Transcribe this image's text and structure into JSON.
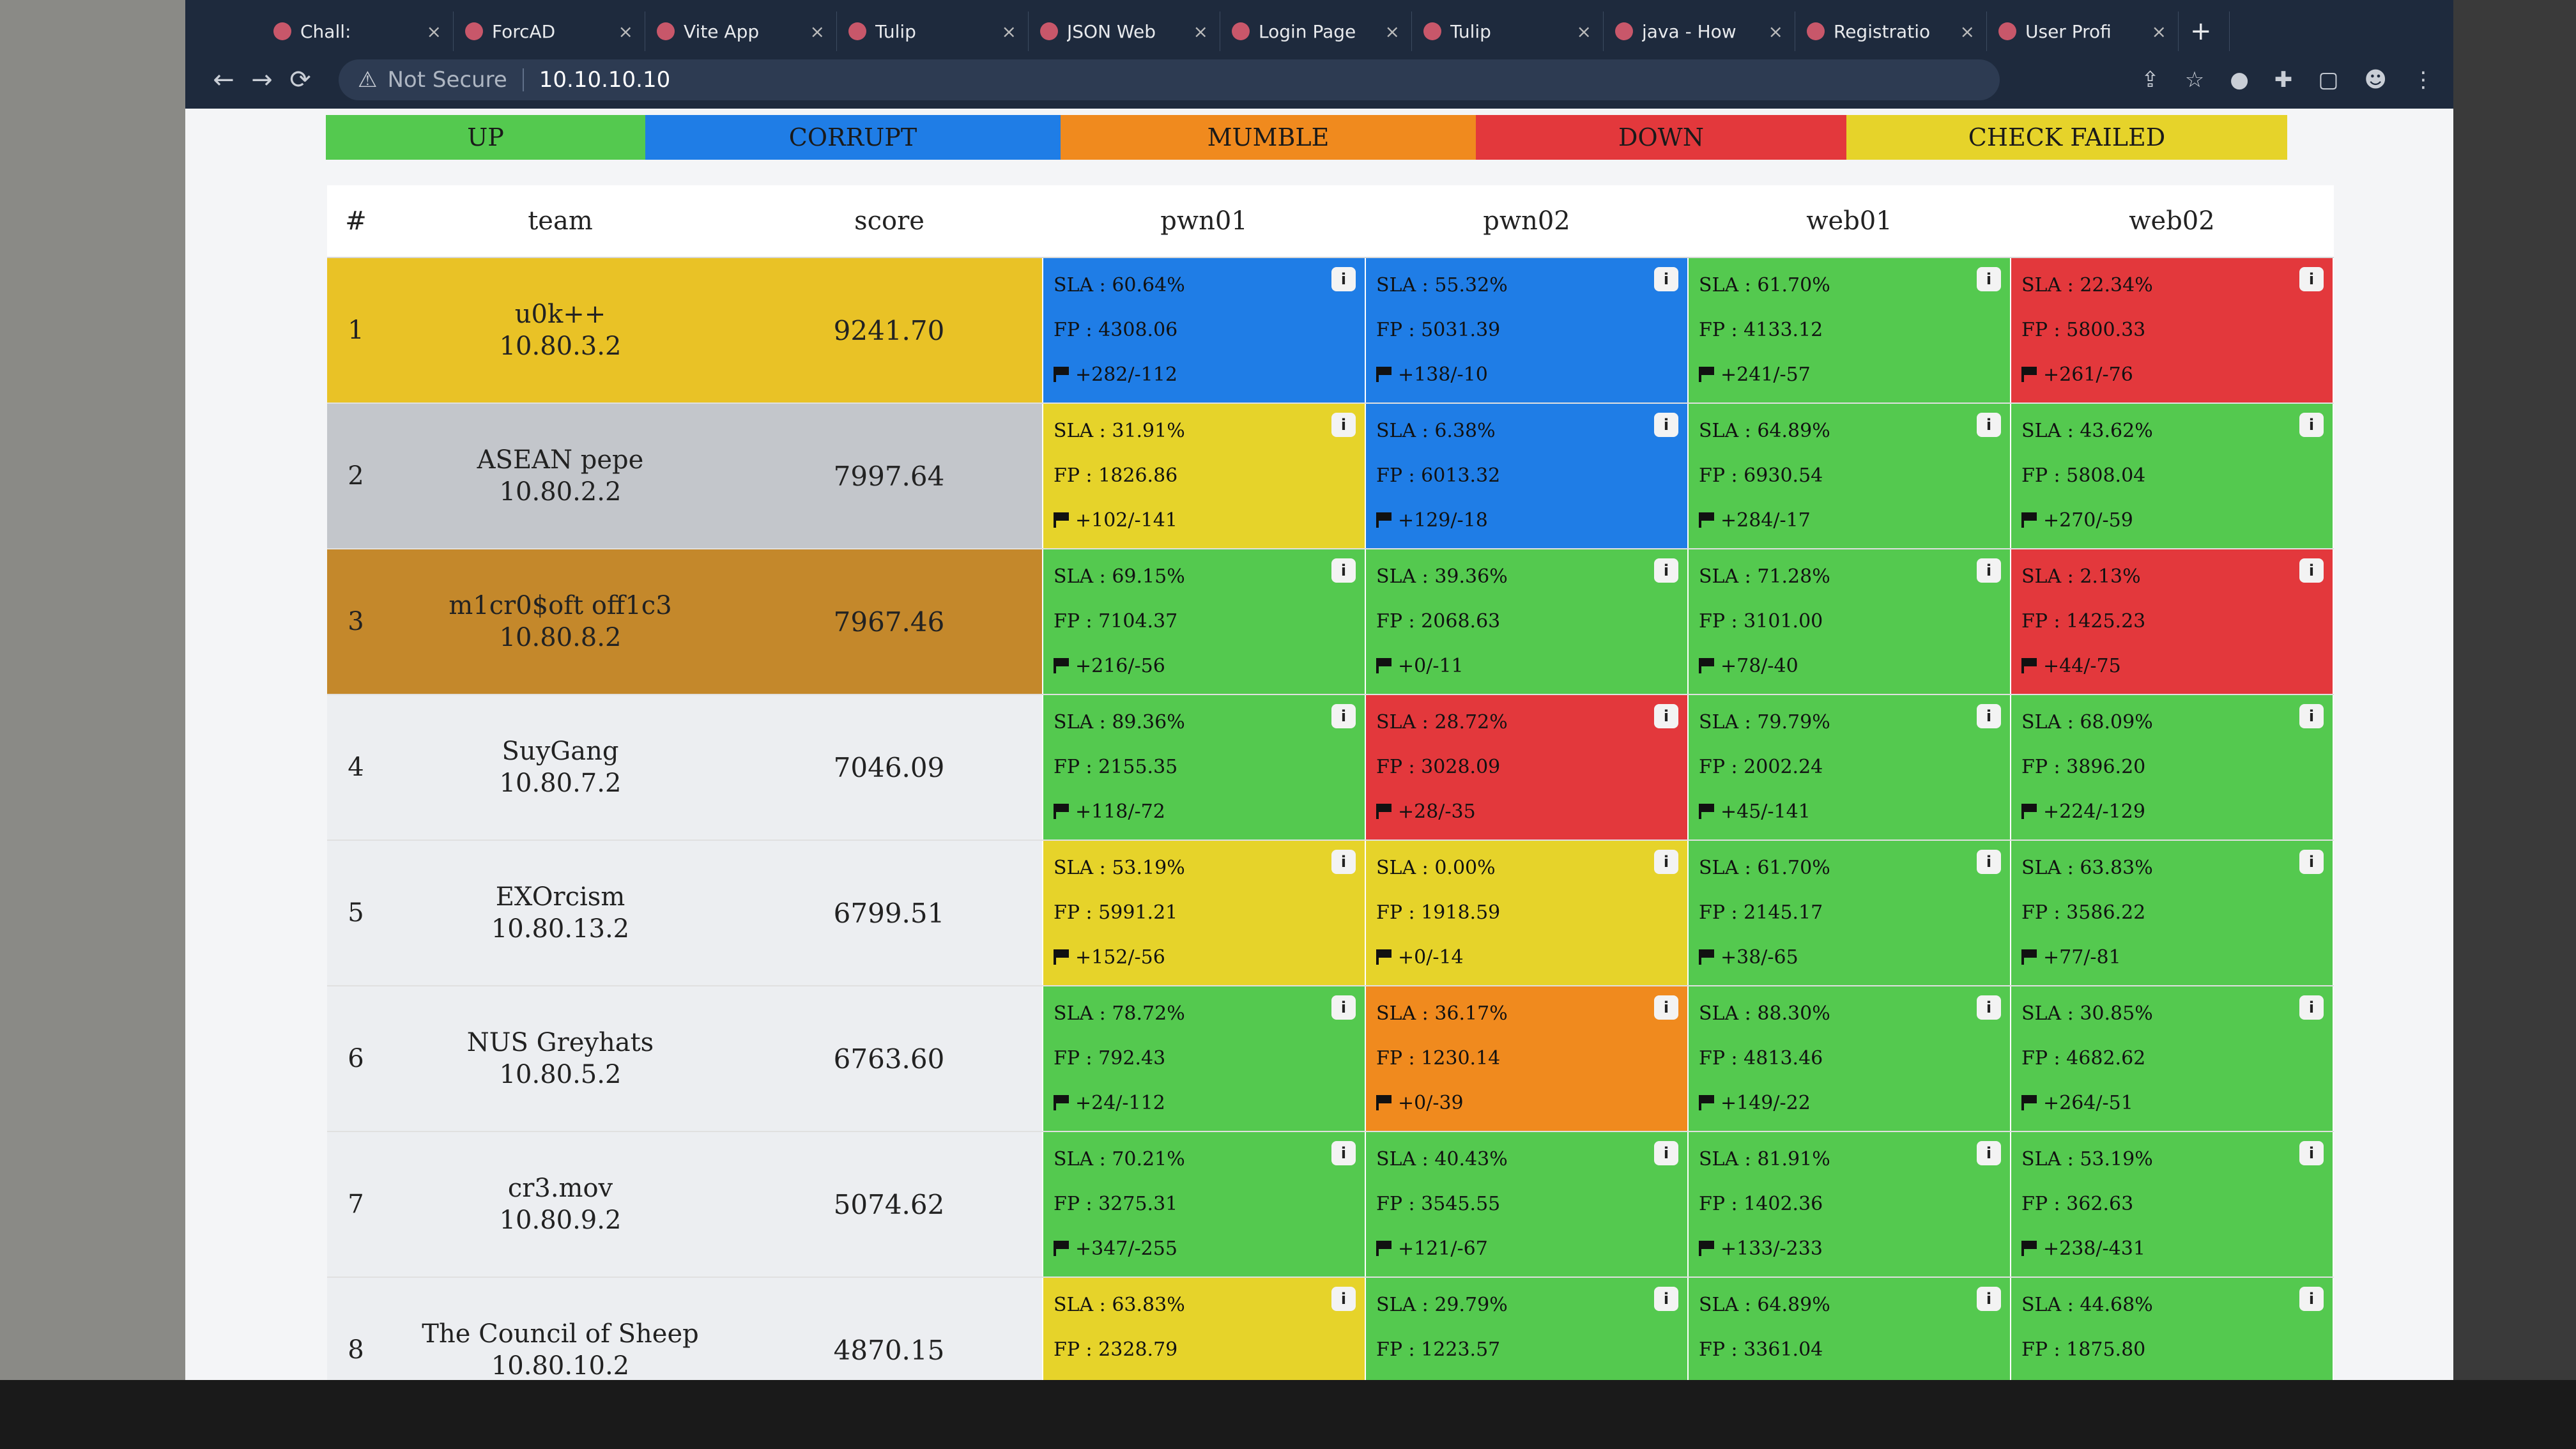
{
  "colors": {
    "UP": "#54c94f",
    "CORRUPT": "#1f7de6",
    "MUMBLE": "#f08a1e",
    "DOWN": "#e3383c",
    "CHECK FAILED": "#e6d32a",
    "rank1": "#e9c226",
    "rank2": "#c3c6cb",
    "rank3": "#c4882b"
  },
  "browser": {
    "tabs": [
      {
        "title": "Chall:",
        "close": "×"
      },
      {
        "title": "ForcAD",
        "close": "×"
      },
      {
        "title": "Vite App",
        "close": "×"
      },
      {
        "title": "Tulip",
        "close": "×"
      },
      {
        "title": "JSON Web",
        "close": "×"
      },
      {
        "title": "Login Page",
        "close": "×"
      },
      {
        "title": "Tulip",
        "close": "×"
      },
      {
        "title": "java - How",
        "close": "×"
      },
      {
        "title": "Registratio",
        "close": "×"
      },
      {
        "title": "User Profi",
        "close": "×"
      }
    ],
    "new_tab": "+",
    "not_secure": "Not Secure",
    "url": "10.10.10.10"
  },
  "legend": [
    "UP",
    "CORRUPT",
    "MUMBLE",
    "DOWN",
    "CHECK FAILED"
  ],
  "table": {
    "headers": [
      "#",
      "team",
      "score",
      "pwn01",
      "pwn02",
      "web01",
      "web02"
    ],
    "rows": [
      {
        "rank": "1",
        "name": "u0k++",
        "ip": "10.80.3.2",
        "score": "9241.70",
        "services": [
          {
            "status": "CORRUPT",
            "sla": "SLA : 60.64%",
            "fp": "FP : 4308.06",
            "flags": "+282/-112"
          },
          {
            "status": "CORRUPT",
            "sla": "SLA : 55.32%",
            "fp": "FP : 5031.39",
            "flags": "+138/-10"
          },
          {
            "status": "UP",
            "sla": "SLA : 61.70%",
            "fp": "FP : 4133.12",
            "flags": "+241/-57"
          },
          {
            "status": "DOWN",
            "sla": "SLA : 22.34%",
            "fp": "FP : 5800.33",
            "flags": "+261/-76"
          }
        ]
      },
      {
        "rank": "2",
        "name": "ASEAN pepe",
        "ip": "10.80.2.2",
        "score": "7997.64",
        "services": [
          {
            "status": "CHECK FAILED",
            "sla": "SLA : 31.91%",
            "fp": "FP : 1826.86",
            "flags": "+102/-141"
          },
          {
            "status": "CORRUPT",
            "sla": "SLA : 6.38%",
            "fp": "FP : 6013.32",
            "flags": "+129/-18"
          },
          {
            "status": "UP",
            "sla": "SLA : 64.89%",
            "fp": "FP : 6930.54",
            "flags": "+284/-17"
          },
          {
            "status": "UP",
            "sla": "SLA : 43.62%",
            "fp": "FP : 5808.04",
            "flags": "+270/-59"
          }
        ]
      },
      {
        "rank": "3",
        "name": "m1cr0$oft off1c3",
        "ip": "10.80.8.2",
        "score": "7967.46",
        "services": [
          {
            "status": "UP",
            "sla": "SLA : 69.15%",
            "fp": "FP : 7104.37",
            "flags": "+216/-56"
          },
          {
            "status": "UP",
            "sla": "SLA : 39.36%",
            "fp": "FP : 2068.63",
            "flags": "+0/-11"
          },
          {
            "status": "UP",
            "sla": "SLA : 71.28%",
            "fp": "FP : 3101.00",
            "flags": "+78/-40"
          },
          {
            "status": "DOWN",
            "sla": "SLA : 2.13%",
            "fp": "FP : 1425.23",
            "flags": "+44/-75"
          }
        ]
      },
      {
        "rank": "4",
        "name": "SuyGang",
        "ip": "10.80.7.2",
        "score": "7046.09",
        "services": [
          {
            "status": "UP",
            "sla": "SLA : 89.36%",
            "fp": "FP : 2155.35",
            "flags": "+118/-72"
          },
          {
            "status": "DOWN",
            "sla": "SLA : 28.72%",
            "fp": "FP : 3028.09",
            "flags": "+28/-35"
          },
          {
            "status": "UP",
            "sla": "SLA : 79.79%",
            "fp": "FP : 2002.24",
            "flags": "+45/-141"
          },
          {
            "status": "UP",
            "sla": "SLA : 68.09%",
            "fp": "FP : 3896.20",
            "flags": "+224/-129"
          }
        ]
      },
      {
        "rank": "5",
        "name": "EXOrcism",
        "ip": "10.80.13.2",
        "score": "6799.51",
        "services": [
          {
            "status": "CHECK FAILED",
            "sla": "SLA : 53.19%",
            "fp": "FP : 5991.21",
            "flags": "+152/-56"
          },
          {
            "status": "CHECK FAILED",
            "sla": "SLA : 0.00%",
            "fp": "FP : 1918.59",
            "flags": "+0/-14"
          },
          {
            "status": "UP",
            "sla": "SLA : 61.70%",
            "fp": "FP : 2145.17",
            "flags": "+38/-65"
          },
          {
            "status": "UP",
            "sla": "SLA : 63.83%",
            "fp": "FP : 3586.22",
            "flags": "+77/-81"
          }
        ]
      },
      {
        "rank": "6",
        "name": "NUS Greyhats",
        "ip": "10.80.5.2",
        "score": "6763.60",
        "services": [
          {
            "status": "UP",
            "sla": "SLA : 78.72%",
            "fp": "FP : 792.43",
            "flags": "+24/-112"
          },
          {
            "status": "MUMBLE",
            "sla": "SLA : 36.17%",
            "fp": "FP : 1230.14",
            "flags": "+0/-39"
          },
          {
            "status": "UP",
            "sla": "SLA : 88.30%",
            "fp": "FP : 4813.46",
            "flags": "+149/-22"
          },
          {
            "status": "UP",
            "sla": "SLA : 30.85%",
            "fp": "FP : 4682.62",
            "flags": "+264/-51"
          }
        ]
      },
      {
        "rank": "7",
        "name": "cr3.mov",
        "ip": "10.80.9.2",
        "score": "5074.62",
        "services": [
          {
            "status": "UP",
            "sla": "SLA : 70.21%",
            "fp": "FP : 3275.31",
            "flags": "+347/-255"
          },
          {
            "status": "UP",
            "sla": "SLA : 40.43%",
            "fp": "FP : 3545.55",
            "flags": "+121/-67"
          },
          {
            "status": "UP",
            "sla": "SLA : 81.91%",
            "fp": "FP : 1402.36",
            "flags": "+133/-233"
          },
          {
            "status": "UP",
            "sla": "SLA : 53.19%",
            "fp": "FP : 362.63",
            "flags": "+238/-431"
          }
        ]
      },
      {
        "rank": "8",
        "name": "The Council of Sheep",
        "ip": "10.80.10.2",
        "score": "4870.15",
        "services": [
          {
            "status": "CHECK FAILED",
            "sla": "SLA : 63.83%",
            "fp": "FP : 2328.79",
            "flags": ""
          },
          {
            "status": "UP",
            "sla": "SLA : 29.79%",
            "fp": "FP : 1223.57",
            "flags": ""
          },
          {
            "status": "UP",
            "sla": "SLA : 64.89%",
            "fp": "FP : 3361.04",
            "flags": ""
          },
          {
            "status": "UP",
            "sla": "SLA : 44.68%",
            "fp": "FP : 1875.80",
            "flags": ""
          }
        ]
      }
    ]
  }
}
